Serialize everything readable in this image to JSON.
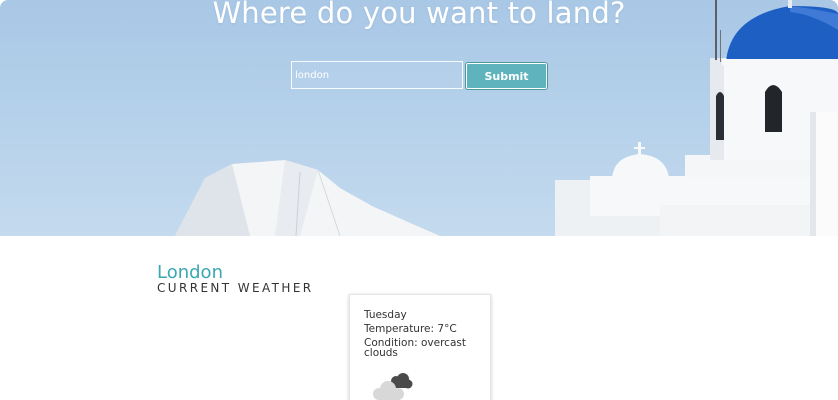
{
  "hero": {
    "title": "Where do you want to land?",
    "search": {
      "value": "london",
      "placeholder": ""
    },
    "submit_label": "Submit"
  },
  "weather": {
    "city": "London",
    "subtitle": "CURRENT WEATHER",
    "card": {
      "day": "Tuesday",
      "temperature": "Temperature: 7°C",
      "condition": "Condition: overcast clouds",
      "icon": "overcast-clouds-icon"
    }
  },
  "colors": {
    "accent": "#3aa8b0",
    "button": "#5fb3bc",
    "sky": "#b4d0ea",
    "dome": "#1e5fc4"
  }
}
